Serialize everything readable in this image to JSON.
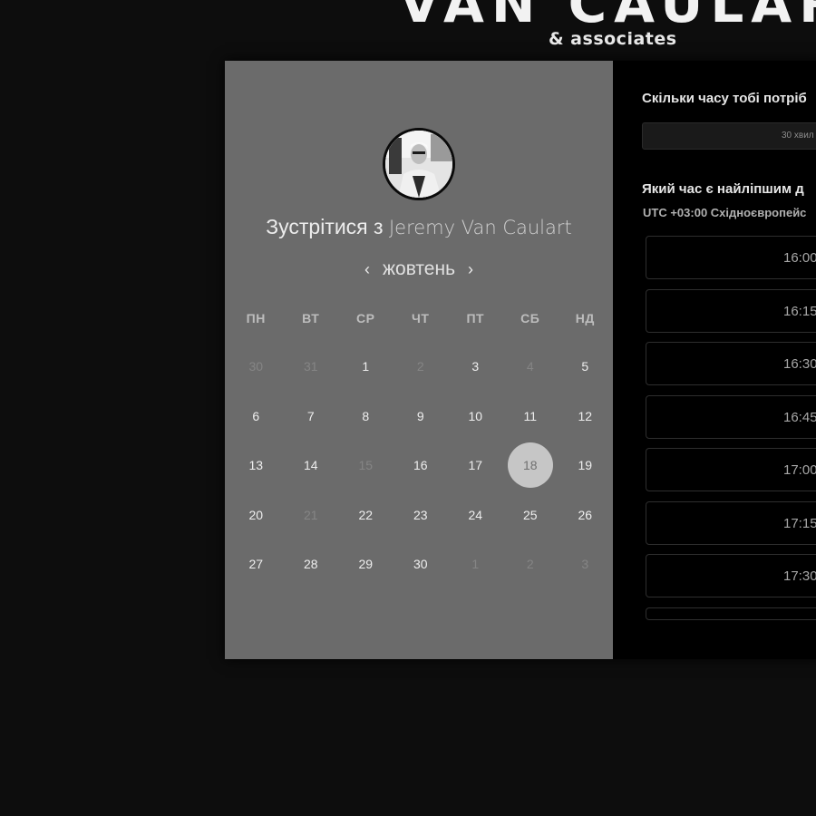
{
  "header": {
    "brand": "VAN CAULART",
    "brand_sub": "& associates"
  },
  "profile": {
    "title_prefix": "Зустрітися з",
    "host_name": "Jeremy Van Caulart"
  },
  "calendar": {
    "prev": "‹",
    "month": "жовтень",
    "next": "›",
    "weekdays": [
      "ПН",
      "ВТ",
      "СР",
      "ЧТ",
      "ПТ",
      "СБ",
      "НД"
    ],
    "weeks": [
      [
        "30",
        "31",
        "1",
        "2",
        "3",
        "4",
        "5"
      ],
      [
        "6",
        "7",
        "8",
        "9",
        "10",
        "11",
        "12"
      ],
      [
        "13",
        "14",
        "15",
        "16",
        "17",
        "18",
        "19"
      ],
      [
        "20",
        "21",
        "22",
        "23",
        "24",
        "25",
        "26"
      ],
      [
        "27",
        "28",
        "29",
        "30",
        "1",
        "2",
        "3"
      ]
    ],
    "selected": "18"
  },
  "booking": {
    "duration_question": "Скільки часу тобі потріб",
    "duration_value": "30 хвил",
    "time_question": "Який час є найліпшим д",
    "timezone": "UTC +03:00 Східноєвропейс",
    "slots": [
      "16:00",
      "16:15",
      "16:30",
      "16:45",
      "17:00",
      "17:15",
      "17:30"
    ]
  }
}
